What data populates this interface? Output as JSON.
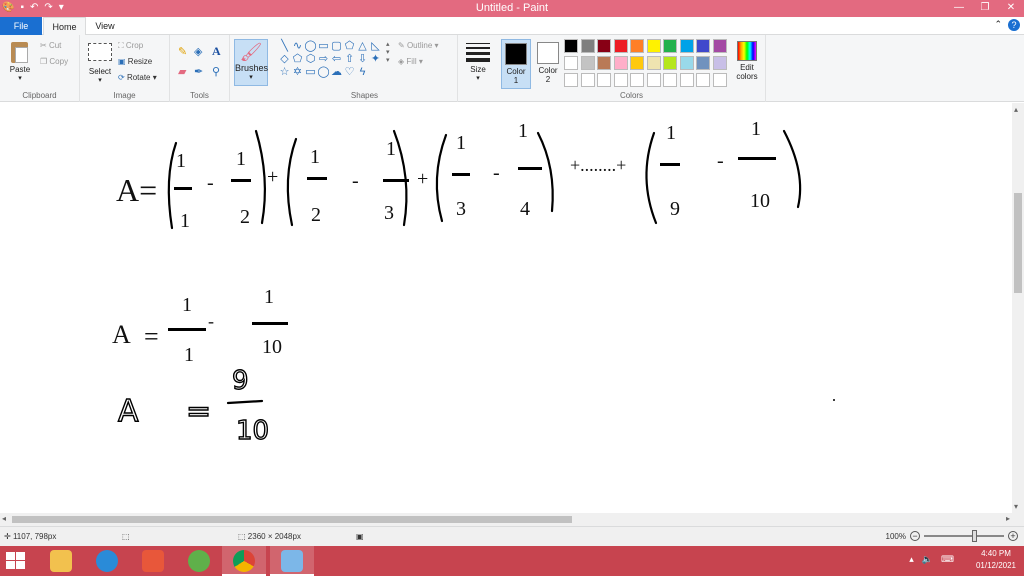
{
  "window": {
    "title": "Untitled - Paint",
    "quick_access": [
      "paint-icon",
      "save-icon",
      "undo-icon",
      "redo-icon",
      "customize-icon"
    ],
    "buttons": [
      "minimize",
      "restore",
      "close"
    ]
  },
  "tabs": [
    {
      "label": "File"
    },
    {
      "label": "Home"
    },
    {
      "label": "View"
    }
  ],
  "ribbon": {
    "clipboard": {
      "label": "Clipboard",
      "paste": "Paste",
      "cut": "Cut",
      "copy": "Copy"
    },
    "image": {
      "label": "Image",
      "select": "Select",
      "crop": "Crop",
      "resize": "Resize",
      "rotate": "Rotate"
    },
    "tools": {
      "label": "Tools"
    },
    "brushes": {
      "label": "Brushes"
    },
    "shapes": {
      "label": "Shapes",
      "outline": "Outline",
      "fill": "Fill"
    },
    "size": {
      "label": "Size"
    },
    "colors": {
      "label": "Colors",
      "color1": "Color 1",
      "color1_value": "#000000",
      "color2": "Color 2",
      "color2_value": "#ffffff",
      "edit": "Edit colors",
      "palette": [
        "#000000",
        "#7f7f7f",
        "#880015",
        "#ed1c24",
        "#ff7f27",
        "#fff200",
        "#22b14c",
        "#00a2e8",
        "#3f48cc",
        "#a349a4",
        "#ffffff",
        "#c3c3c3",
        "#b97a57",
        "#ffaec9",
        "#ffc90e",
        "#efe4b0",
        "#b5e61d",
        "#99d9ea",
        "#7092be",
        "#c8bfe7",
        "#ffffff",
        "#ffffff",
        "#ffffff",
        "#ffffff",
        "#ffffff",
        "#ffffff",
        "#ffffff",
        "#ffffff",
        "#ffffff",
        "#ffffff"
      ]
    }
  },
  "canvas": {
    "line1": {
      "lhs": "A=",
      "terms": [
        {
          "a": "1",
          "b": "1",
          "c": "2"
        },
        {
          "a": "1",
          "b": "2",
          "c": "3"
        },
        {
          "a": "1",
          "b": "3",
          "c": "4"
        }
      ],
      "dots": "+........+",
      "last": {
        "b": "9",
        "c": "10"
      }
    },
    "line2": {
      "lhs": "A",
      "eq": "=",
      "n1": "1",
      "d1": "1",
      "n2": "1",
      "d2": "10"
    },
    "line3": {
      "lhs": "A",
      "eq": "=",
      "n": "9",
      "d": "10"
    }
  },
  "status": {
    "cursor": "1107, 798px",
    "size": "2360 × 2048px",
    "zoom": "100%"
  },
  "taskbar": {
    "time": "4:40 PM",
    "date": "01/12/2021",
    "apps": [
      "file-explorer",
      "internet-explorer",
      "media-app",
      "green-app",
      "chrome",
      "paint"
    ]
  }
}
